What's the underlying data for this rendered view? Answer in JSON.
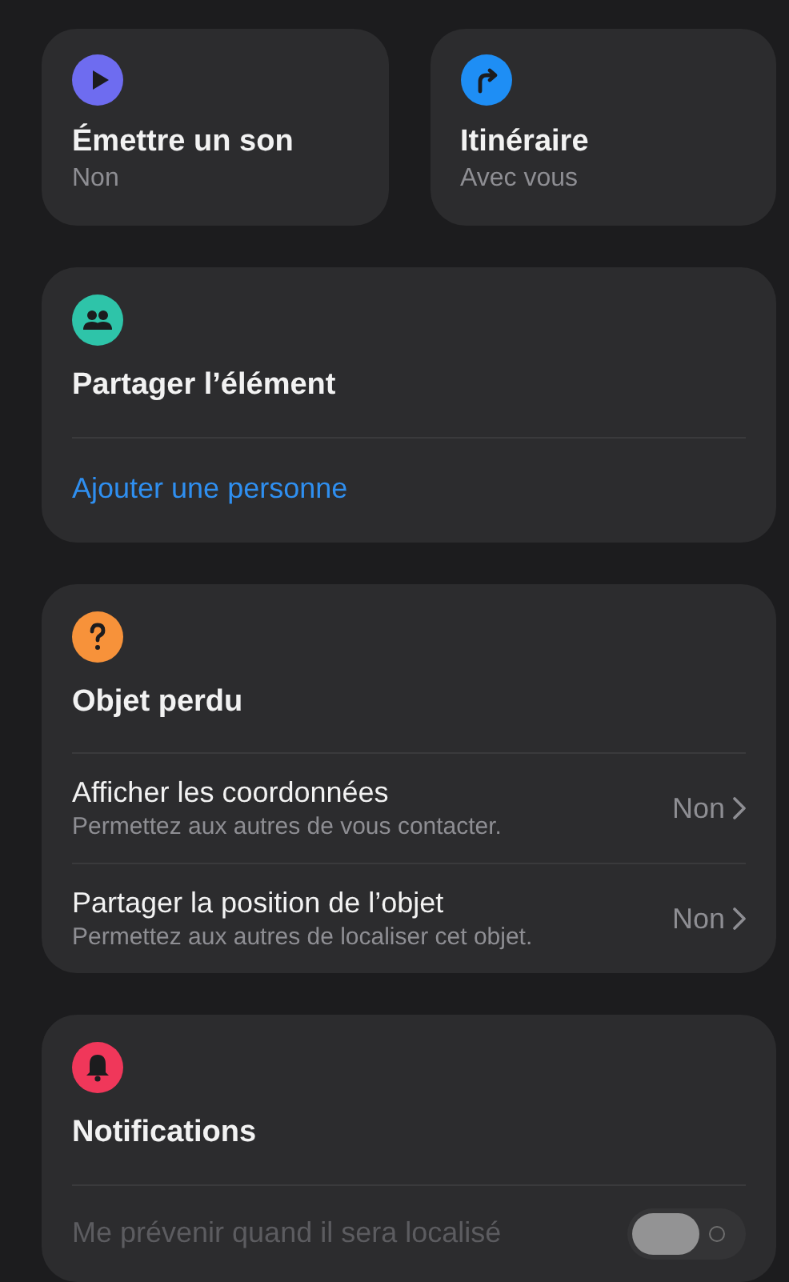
{
  "actions": [
    {
      "color": "#6e6cf0",
      "title": "Émettre un son",
      "subtitle": "Non"
    },
    {
      "color": "#1e8ef5",
      "title": "Itinéraire",
      "subtitle": "Avec vous"
    }
  ],
  "sections": [
    {
      "color": "#2ec4a9",
      "title": "Partager l’élément",
      "rows": [
        {
          "kind": "link",
          "label": "Ajouter une personne"
        }
      ]
    },
    {
      "color": "#f7923a",
      "title": "Objet perdu",
      "rows": [
        {
          "kind": "nav",
          "label": "Afficher les coordonnées",
          "detail": "Permettez aux autres de vous contacter.",
          "value": "Non"
        },
        {
          "kind": "nav",
          "label": "Partager la position de l’objet",
          "detail": "Permettez aux autres de localiser cet objet.",
          "value": "Non"
        }
      ]
    },
    {
      "color": "#f0375a",
      "title": "Notifications",
      "rows": [
        {
          "kind": "toggle",
          "label": "Me prévenir quand il sera localisé",
          "on": false,
          "disabled": true
        }
      ]
    }
  ]
}
